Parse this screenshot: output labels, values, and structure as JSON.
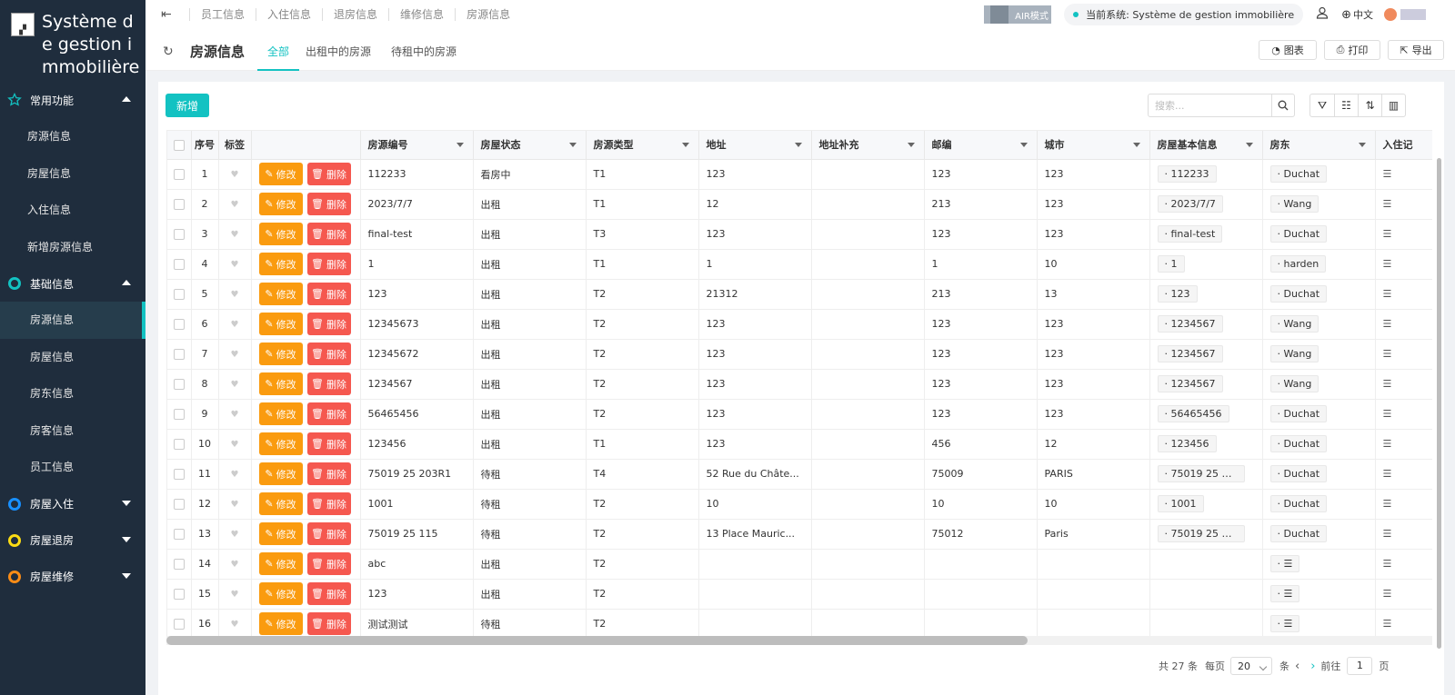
{
  "sidebar": {
    "brand_title": "Système de gestion immobilière",
    "groups": [
      {
        "label": "常用功能",
        "color": "#13c2c2",
        "expanded": true,
        "items": [
          "房源信息",
          "房屋信息",
          "入住信息",
          "新增房源信息"
        ]
      },
      {
        "label": "基础信息",
        "color": "#13c2c2",
        "expanded": true,
        "items": [
          "房源信息",
          "房屋信息",
          "房东信息",
          "房客信息",
          "员工信息"
        ]
      },
      {
        "label": "房屋入住",
        "color": "#1890ff",
        "expanded": false
      },
      {
        "label": "房屋退房",
        "color": "#fadb14",
        "expanded": false
      },
      {
        "label": "房屋维修",
        "color": "#fa8c16",
        "expanded": false
      }
    ],
    "active_item": "房源信息"
  },
  "topbar": {
    "tabs": [
      "员工信息",
      "入住信息",
      "退房信息",
      "维修信息",
      "房源信息"
    ],
    "air_mode": "AIR模式",
    "current_system": "当前系统: Système de gestion immobilière",
    "language": "中文"
  },
  "header": {
    "title": "房源信息",
    "tabs": [
      "全部",
      "出租中的房源",
      "待租中的房源"
    ],
    "active_tab": "全部",
    "buttons": {
      "chart": "图表",
      "print": "打印",
      "export": "导出"
    }
  },
  "toolbar": {
    "add_label": "新增",
    "search_placeholder": "搜索..."
  },
  "table": {
    "columns": [
      "序号",
      "标签",
      "房源编号",
      "房屋状态",
      "房源类型",
      "地址",
      "地址补充",
      "邮编",
      "城市",
      "房屋基本信息",
      "房东",
      "入住记"
    ],
    "edit_label": "修改",
    "delete_label": "删除",
    "rows": [
      {
        "no": "1",
        "code": "112233",
        "status": "看房中",
        "type": "T1",
        "addr": "123",
        "addr2": "",
        "zip": "123",
        "city": "123",
        "info": "112233",
        "owner": "Duchat"
      },
      {
        "no": "2",
        "code": "2023/7/7",
        "status": "出租",
        "type": "T1",
        "addr": "12",
        "addr2": "",
        "zip": "213",
        "city": "123",
        "info": "2023/7/7",
        "owner": "Wang"
      },
      {
        "no": "3",
        "code": "final-test",
        "status": "出租",
        "type": "T3",
        "addr": "123",
        "addr2": "",
        "zip": "123",
        "city": "123",
        "info": "final-test",
        "owner": "Duchat"
      },
      {
        "no": "4",
        "code": "1",
        "status": "出租",
        "type": "T1",
        "addr": "1",
        "addr2": "",
        "zip": "1",
        "city": "10",
        "info": "1",
        "owner": "harden"
      },
      {
        "no": "5",
        "code": "123",
        "status": "出租",
        "type": "T2",
        "addr": "21312",
        "addr2": "",
        "zip": "213",
        "city": "13",
        "info": "123",
        "owner": "Duchat"
      },
      {
        "no": "6",
        "code": "12345673",
        "status": "出租",
        "type": "T2",
        "addr": "123",
        "addr2": "",
        "zip": "123",
        "city": "123",
        "info": "1234567",
        "owner": "Wang"
      },
      {
        "no": "7",
        "code": "12345672",
        "status": "出租",
        "type": "T2",
        "addr": "123",
        "addr2": "",
        "zip": "123",
        "city": "123",
        "info": "1234567",
        "owner": "Wang"
      },
      {
        "no": "8",
        "code": "1234567",
        "status": "出租",
        "type": "T2",
        "addr": "123",
        "addr2": "",
        "zip": "123",
        "city": "123",
        "info": "1234567",
        "owner": "Wang"
      },
      {
        "no": "9",
        "code": "56465456",
        "status": "出租",
        "type": "T2",
        "addr": "123",
        "addr2": "",
        "zip": "123",
        "city": "123",
        "info": "56465456",
        "owner": "Duchat"
      },
      {
        "no": "10",
        "code": "123456",
        "status": "出租",
        "type": "T1",
        "addr": "123",
        "addr2": "",
        "zip": "456",
        "city": "12",
        "info": "123456",
        "owner": "Duchat"
      },
      {
        "no": "11",
        "code": "75019 25 203R1",
        "status": "待租",
        "type": "T4",
        "addr": "52 Rue du Châte...",
        "addr2": "",
        "zip": "75009",
        "city": "PARIS",
        "info": "75019 25 20...",
        "owner": "Duchat"
      },
      {
        "no": "12",
        "code": "1001",
        "status": "待租",
        "type": "T2",
        "addr": "10",
        "addr2": "",
        "zip": "10",
        "city": "10",
        "info": "1001",
        "owner": "Duchat"
      },
      {
        "no": "13",
        "code": "75019 25 115",
        "status": "待租",
        "type": "T2",
        "addr": "13 Place Mauric...",
        "addr2": "",
        "zip": "75012",
        "city": "Paris",
        "info": "75019 25 115",
        "owner": "Duchat"
      },
      {
        "no": "14",
        "code": "abc",
        "status": "出租",
        "type": "T2",
        "addr": "",
        "addr2": "",
        "zip": "",
        "city": "",
        "info": "",
        "owner": "☰"
      },
      {
        "no": "15",
        "code": "123",
        "status": "出租",
        "type": "T2",
        "addr": "",
        "addr2": "",
        "zip": "",
        "city": "",
        "info": "",
        "owner": "☰"
      },
      {
        "no": "16",
        "code": "测试测试",
        "status": "待租",
        "type": "T2",
        "addr": "",
        "addr2": "",
        "zip": "",
        "city": "",
        "info": "",
        "owner": "☰"
      }
    ]
  },
  "pagination": {
    "total": "共 27 条",
    "per_page_label": "每页",
    "per_page": "20",
    "unit": "条",
    "goto_label": "前往",
    "page": "1",
    "page_unit": "页"
  }
}
